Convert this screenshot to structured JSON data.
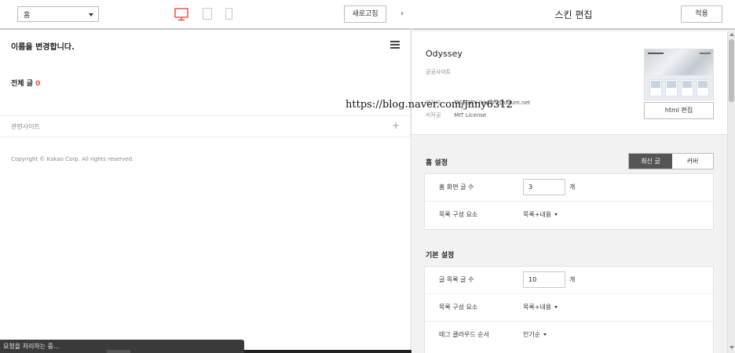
{
  "left_toolbar": {
    "page_select_value": "홈",
    "refresh_label": "새로고침",
    "collapse_glyph": "›"
  },
  "preview": {
    "blog_title": "이름을 변경합니다.",
    "post_count_label": "전체 글",
    "post_count_value": "0",
    "related_sites_label": "관련사이트",
    "related_plus": "+",
    "copyright": "Copyright © Kakao Corp. All rights reserved."
  },
  "status_bar": {
    "text": "요청을 처리하는 중..."
  },
  "skin_editor": {
    "title": "스킨 편집",
    "apply_label": "적용",
    "skin": {
      "name": "Odyssey",
      "type": "공공사이트",
      "maker_key": "제작자",
      "maker_value": "TISTORY (tistory@daum.net",
      "license_key": "저작권",
      "license_value": "MIT License",
      "html_edit_label": "html 편집"
    },
    "home_settings": {
      "title": "홈 설정",
      "seg_latest": "최신 글",
      "seg_cover": "커버",
      "rows": [
        {
          "label": "홈 화면 글 수",
          "value": "3",
          "unit": "개"
        },
        {
          "label": "목록 구성 요소",
          "value": "목록+내용"
        }
      ]
    },
    "basic_settings": {
      "title": "기본 설정",
      "rows": [
        {
          "label": "글 목록 글 수",
          "value": "10",
          "unit": "개"
        },
        {
          "label": "목록 구성 요소",
          "value": "목록+내용"
        },
        {
          "label": "태그 클라우드 순서",
          "value": "인기순"
        }
      ]
    }
  },
  "watermark": "https://blog.naver.com/jnny6312",
  "colors": {
    "accent_red": "#e94b35",
    "segment_active": "#555555"
  }
}
